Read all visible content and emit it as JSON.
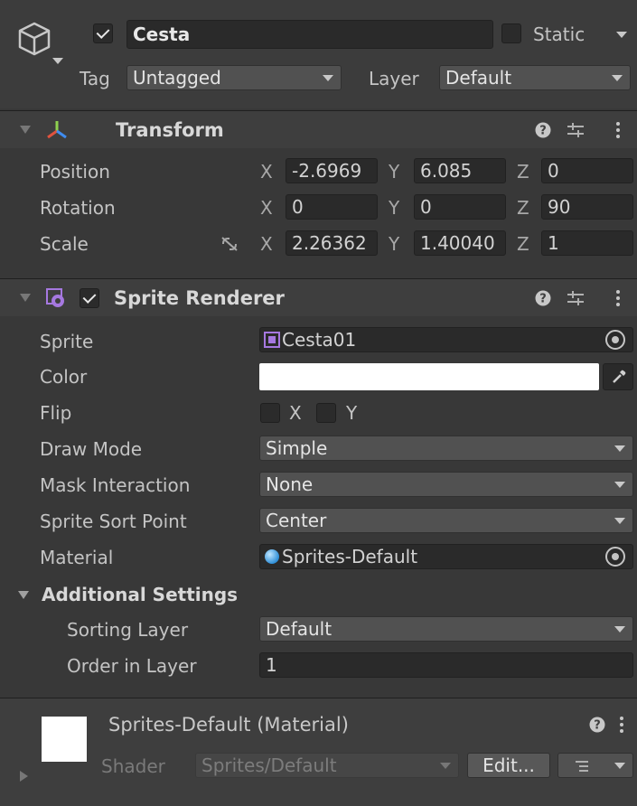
{
  "gameobject": {
    "active_checked": true,
    "name": "Cesta",
    "static_checked": false,
    "static_label": "Static",
    "tag_label": "Tag",
    "tag_value": "Untagged",
    "layer_label": "Layer",
    "layer_value": "Default"
  },
  "transform": {
    "title": "Transform",
    "rows": [
      {
        "label": "Position",
        "x": "-2.6969",
        "y": "6.085",
        "z": "0"
      },
      {
        "label": "Rotation",
        "x": "0",
        "y": "0",
        "z": "90"
      },
      {
        "label": "Scale",
        "x": "2.26362",
        "y": "1.40040",
        "z": "1"
      }
    ],
    "axis_x": "X",
    "axis_y": "Y",
    "axis_z": "Z"
  },
  "sprite_renderer": {
    "enabled": true,
    "title": "Sprite Renderer",
    "sprite_label": "Sprite",
    "sprite_value": "Cesta01",
    "color_label": "Color",
    "color_value": "#ffffff",
    "flip_label": "Flip",
    "flip_x": "X",
    "flip_y": "Y",
    "draw_mode_label": "Draw Mode",
    "draw_mode_value": "Simple",
    "mask_label": "Mask Interaction",
    "mask_value": "None",
    "sort_point_label": "Sprite Sort Point",
    "sort_point_value": "Center",
    "material_label": "Material",
    "material_value": "Sprites-Default",
    "additional_settings_title": "Additional Settings",
    "sorting_layer_label": "Sorting Layer",
    "sorting_layer_value": "Default",
    "order_label": "Order in Layer",
    "order_value": "1"
  },
  "material": {
    "title": "Sprites-Default (Material)",
    "shader_label": "Shader",
    "shader_value": "Sprites/Default",
    "edit_label": "Edit..."
  },
  "colors": {
    "background": "#383838",
    "field": "#2a2a2a",
    "dropdown": "#515151",
    "header": "#3e3e3e"
  }
}
